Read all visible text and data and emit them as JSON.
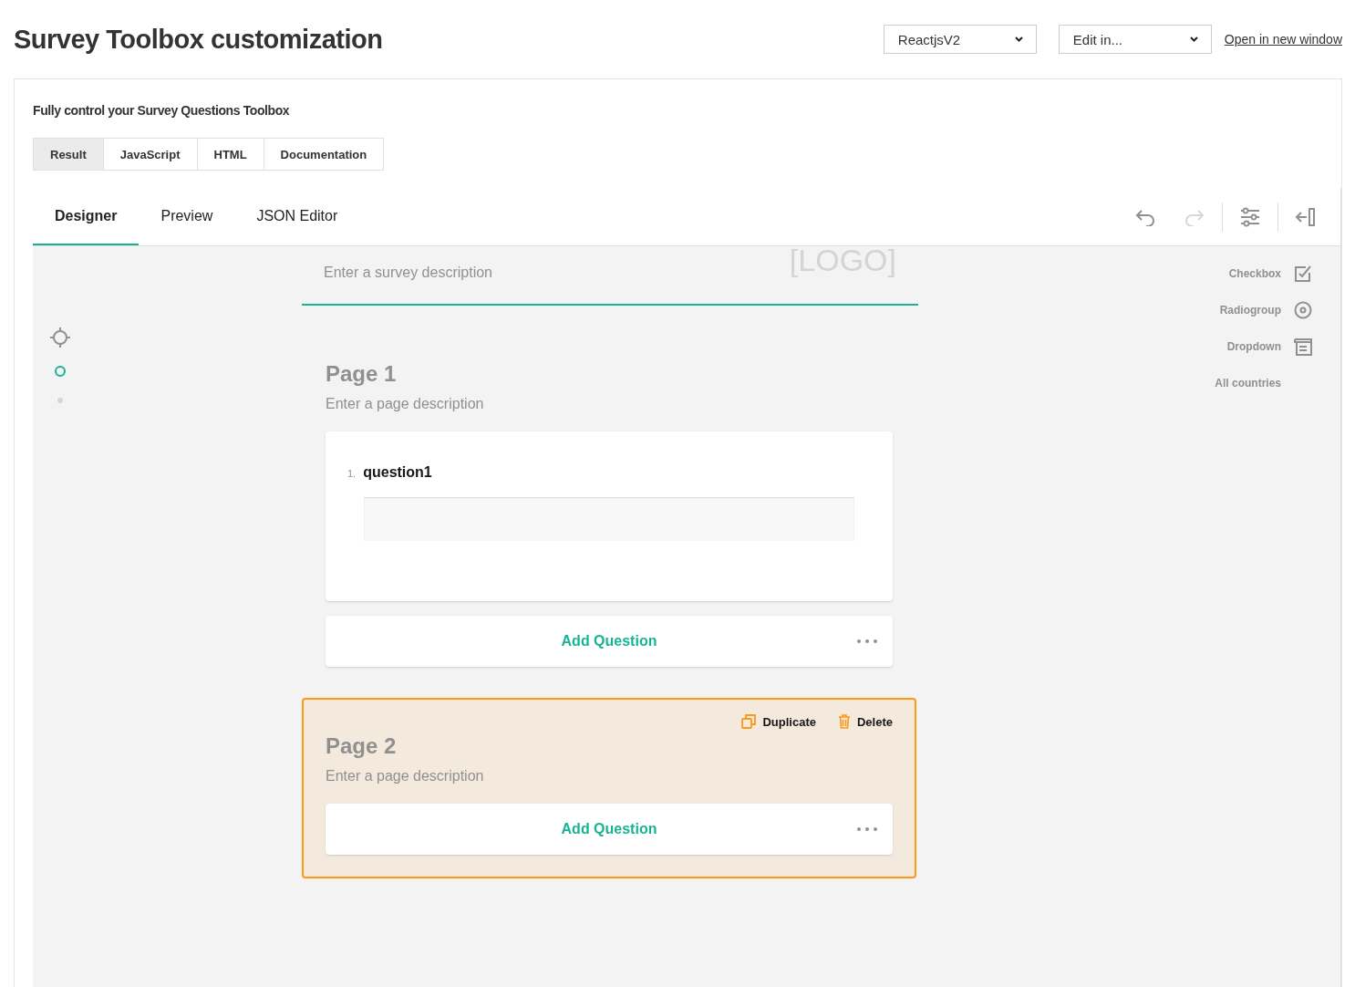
{
  "header": {
    "title": "Survey Toolbox customization",
    "selects": [
      {
        "value": "ReactjsV2"
      },
      {
        "value": "Edit in..."
      }
    ],
    "link": "Open in new window"
  },
  "card": {
    "subtitle": "Fully control your Survey Questions Toolbox",
    "tabs": [
      {
        "label": "Result",
        "selected": true
      },
      {
        "label": "JavaScript",
        "selected": false
      },
      {
        "label": "HTML",
        "selected": false
      },
      {
        "label": "Documentation",
        "selected": false
      }
    ],
    "designer": {
      "tabs": [
        {
          "label": "Designer",
          "selected": true
        },
        {
          "label": "Preview",
          "selected": false
        },
        {
          "label": "JSON Editor",
          "selected": false
        }
      ],
      "toolbar": [
        {
          "kind": "undo",
          "disabled": false
        },
        {
          "kind": "redo",
          "disabled": true
        },
        {
          "kind": "separator"
        },
        {
          "kind": "settings"
        },
        {
          "kind": "separator"
        },
        {
          "kind": "collapse"
        }
      ],
      "navigator": [
        {
          "kind": "target"
        },
        {
          "kind": "page",
          "selected": true
        },
        {
          "kind": "page",
          "selected": false
        }
      ],
      "survey": {
        "description": "Enter a survey description",
        "logo": "[LOGO]"
      },
      "pages": [
        {
          "title": "Page 1",
          "description": "Enter a page description",
          "selected": false,
          "questions": [
            {
              "number": "1.",
              "title": "question1"
            }
          ],
          "add_label": "Add Question"
        },
        {
          "title": "Page 2",
          "description": "Enter a page description",
          "selected": true,
          "add_label": "Add Question",
          "actions": [
            {
              "kind": "duplicate",
              "label": "Duplicate"
            },
            {
              "kind": "delete",
              "label": "Delete"
            }
          ]
        }
      ],
      "toolbox": [
        {
          "kind": "checkbox",
          "label": "Checkbox"
        },
        {
          "kind": "radiogroup",
          "label": "Radiogroup"
        },
        {
          "kind": "dropdown",
          "label": "Dropdown"
        },
        {
          "kind": "custom",
          "label": "All countries"
        }
      ]
    }
  }
}
